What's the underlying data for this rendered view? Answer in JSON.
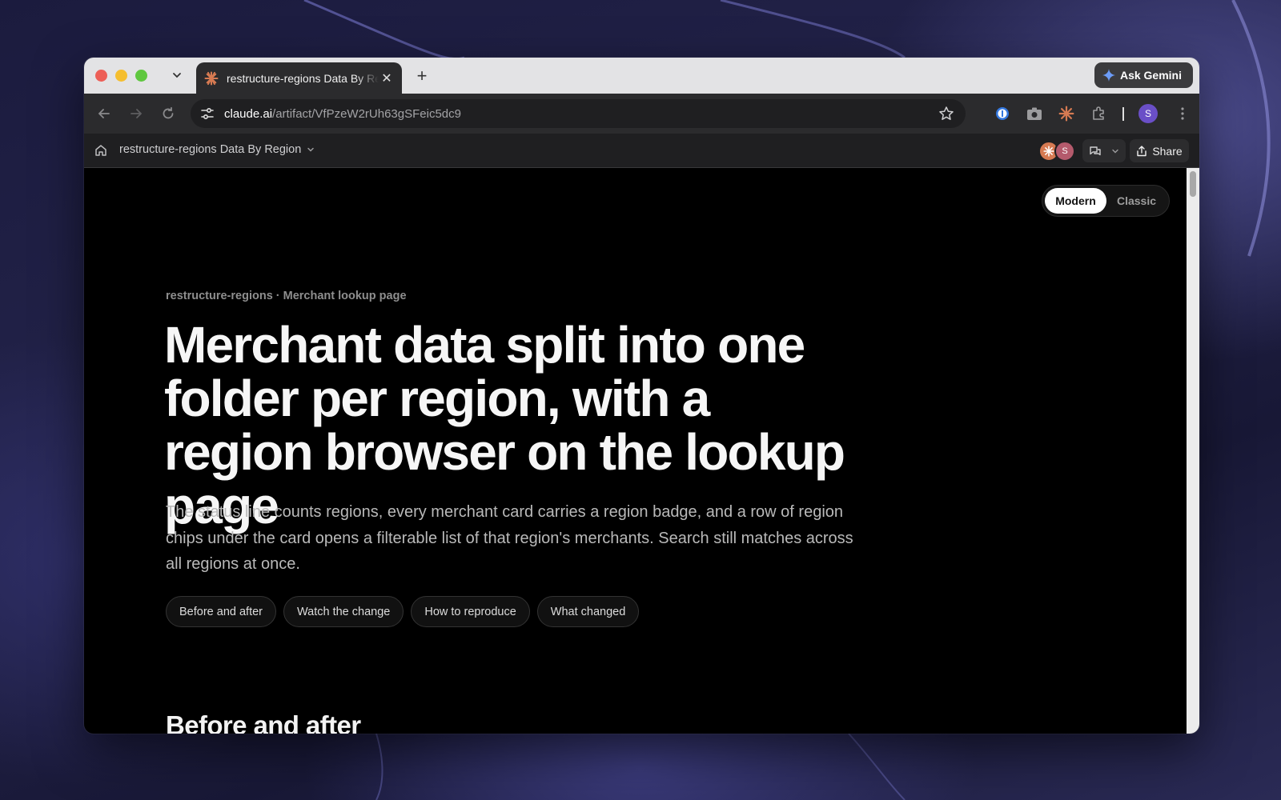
{
  "browser": {
    "tab_title": "restructure-regions Data By Region",
    "new_tab_label": "+",
    "ask_gemini_label": "Ask Gemini",
    "url_host": "claude.ai",
    "url_path": "/artifact/VfPzeW2rUh63gSFeic5dc9",
    "profile_initial": "S"
  },
  "appbar": {
    "breadcrumb": "restructure-regions Data By Region",
    "avatar_initial": "S",
    "share_label": "Share"
  },
  "page": {
    "mode_toggle": {
      "active": "Modern",
      "inactive": "Classic"
    },
    "eyebrow": "restructure-regions · Merchant lookup page",
    "headline": "Merchant data split into one folder per region, with a region browser on the lookup page",
    "lede": "The status line counts regions, every merchant card carries a region badge, and a row of region chips under the card opens a filterable list of that region's merchants. Search still matches across all regions at once.",
    "pills": [
      "Before and after",
      "Watch the change",
      "How to reproduce",
      "What changed"
    ],
    "section_title": "Before and after"
  },
  "colors": {
    "accent_claude": "#d67a52",
    "profile": "#6a4fc7",
    "content_bg": "#000000"
  }
}
